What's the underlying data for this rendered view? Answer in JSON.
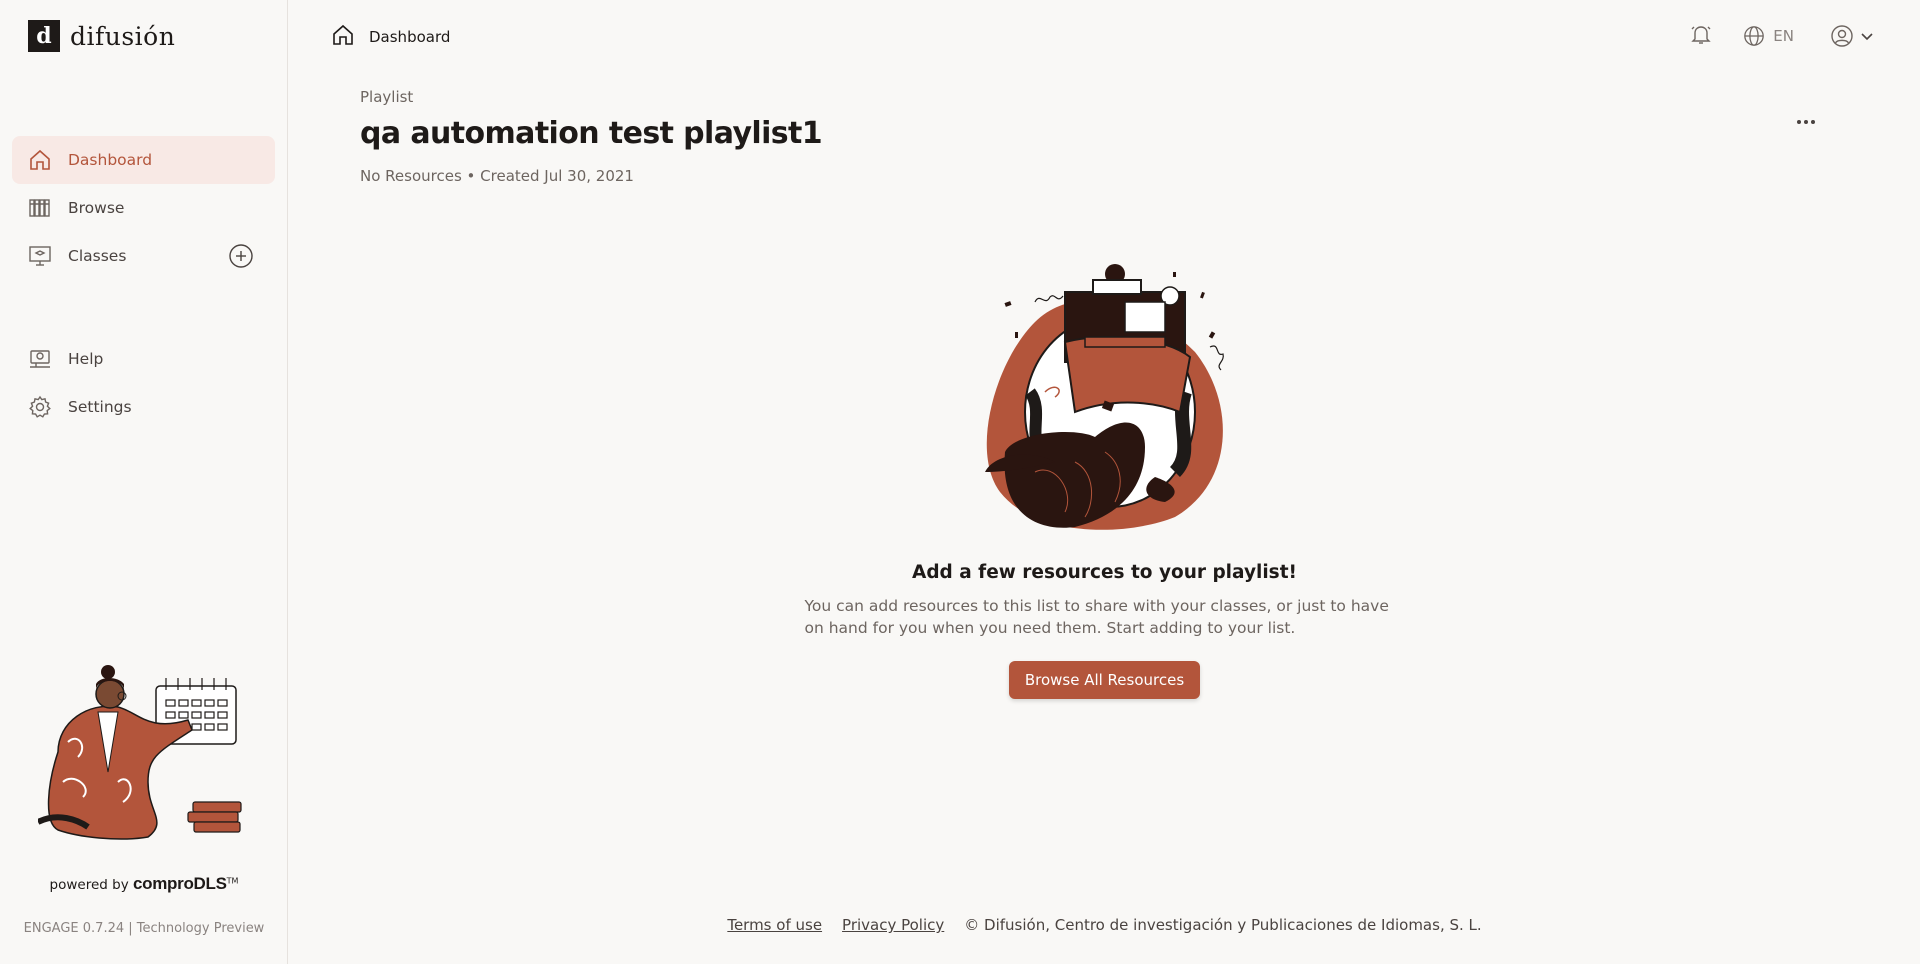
{
  "brand": {
    "logo_text": "difusión",
    "logo_mark": "d"
  },
  "sidebar": {
    "items": [
      {
        "label": "Dashboard",
        "icon": "home-icon",
        "active": true
      },
      {
        "label": "Browse",
        "icon": "books-icon"
      },
      {
        "label": "Classes",
        "icon": "classroom-icon"
      },
      {
        "label": "Help",
        "icon": "help-icon"
      },
      {
        "label": "Settings",
        "icon": "gear-icon"
      }
    ],
    "powered_prefix": "powered by",
    "powered_brand": "comproDLS",
    "powered_tm": "TM",
    "version": "ENGAGE 0.7.24 | Technology Preview"
  },
  "topbar": {
    "breadcrumb": "Dashboard",
    "language": "EN"
  },
  "playlist": {
    "eyebrow": "Playlist",
    "title": "qa automation test playlist1",
    "meta": "No Resources • Created Jul 30, 2021"
  },
  "empty_state": {
    "title": "Add a few resources to your playlist!",
    "description": "You can add resources to this list to share with your classes, or just to have on hand for you when you need them. Start adding to your list.",
    "button": "Browse All Resources"
  },
  "footer": {
    "terms": "Terms of use",
    "privacy": "Privacy Policy",
    "copyright": "© Difusión, Centro de investigación y Publicaciones de Idiomas, S. L."
  },
  "colors": {
    "accent": "#b3553b",
    "active_bg": "#f8e9e5",
    "background": "#f9f8f6"
  }
}
